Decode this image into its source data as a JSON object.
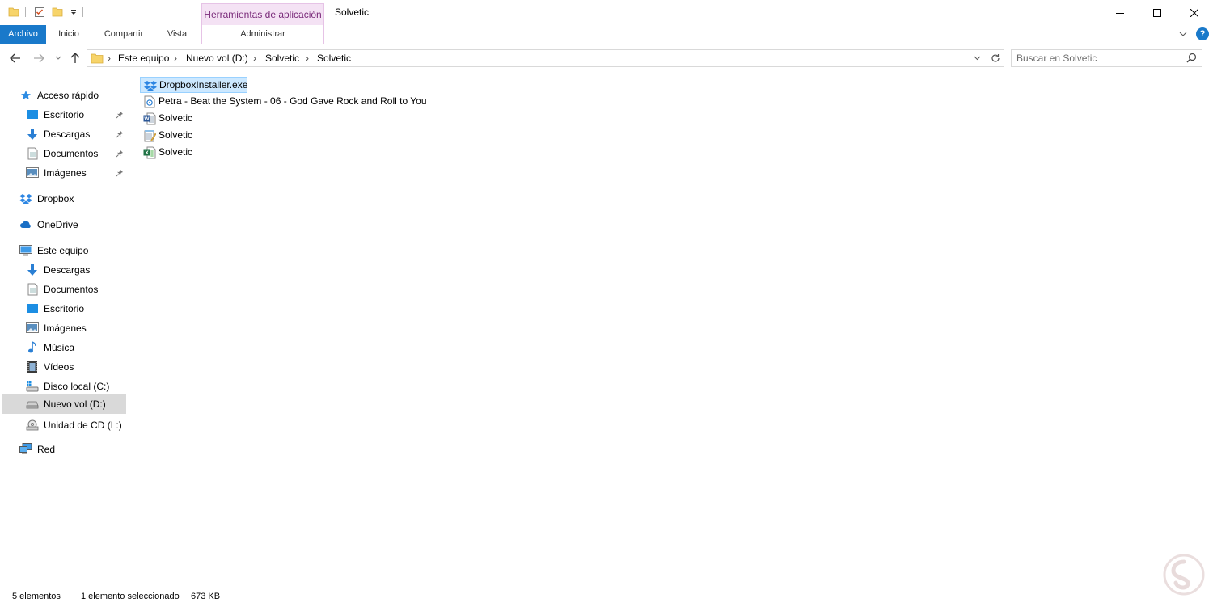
{
  "window": {
    "title": "Solvetic",
    "context_tools_label": "Herramientas de aplicación"
  },
  "ribbon": {
    "tabs": [
      {
        "label": "Archivo"
      },
      {
        "label": "Inicio"
      },
      {
        "label": "Compartir"
      },
      {
        "label": "Vista"
      },
      {
        "label": "Administrar"
      }
    ],
    "help_label": "?"
  },
  "address": {
    "crumbs": [
      "Este equipo",
      "Nuevo vol (D:)",
      "Solvetic",
      "Solvetic"
    ],
    "separator": "›"
  },
  "search": {
    "placeholder": "Buscar en Solvetic"
  },
  "sidebar": {
    "items": [
      {
        "label": "Acceso rápido",
        "icon": "star-icon"
      },
      {
        "label": "Escritorio",
        "icon": "desktop-icon",
        "pinned": true
      },
      {
        "label": "Descargas",
        "icon": "download-icon",
        "pinned": true
      },
      {
        "label": "Documentos",
        "icon": "documents-icon",
        "pinned": true
      },
      {
        "label": "Imágenes",
        "icon": "pictures-icon",
        "pinned": true
      },
      {
        "label": "Dropbox",
        "icon": "dropbox-icon"
      },
      {
        "label": "OneDrive",
        "icon": "onedrive-icon"
      },
      {
        "label": "Este equipo",
        "icon": "computer-icon"
      },
      {
        "label": "Descargas",
        "icon": "download-icon"
      },
      {
        "label": "Documentos",
        "icon": "documents-icon"
      },
      {
        "label": "Escritorio",
        "icon": "desktop-icon"
      },
      {
        "label": "Imágenes",
        "icon": "pictures-icon"
      },
      {
        "label": "Música",
        "icon": "music-icon"
      },
      {
        "label": "Vídeos",
        "icon": "videos-icon"
      },
      {
        "label": "Disco local (C:)",
        "icon": "drive-icon"
      },
      {
        "label": "Nuevo vol (D:)",
        "icon": "drive-icon",
        "selected": true
      },
      {
        "label": "Unidad de CD (L:)",
        "icon": "cd-drive-icon"
      },
      {
        "label": "Red",
        "icon": "network-icon"
      }
    ]
  },
  "files": [
    {
      "name": "DropboxInstaller.exe",
      "icon": "dropbox-exe-icon",
      "selected": true
    },
    {
      "name": "Petra - Beat the System - 06 - God Gave Rock and Roll to You",
      "icon": "media-file-icon"
    },
    {
      "name": "Solvetic",
      "icon": "word-doc-icon"
    },
    {
      "name": "Solvetic",
      "icon": "notepad-file-icon"
    },
    {
      "name": "Solvetic",
      "icon": "excel-file-icon"
    }
  ],
  "status": {
    "count": "5 elementos",
    "selection": "1 elemento seleccionado",
    "size": "673 KB"
  },
  "colors": {
    "accent": "#1979ca",
    "context_tab": "#f4e2f4",
    "selected_file": "#cce8ff",
    "selected_nav": "#d9d9d9"
  }
}
